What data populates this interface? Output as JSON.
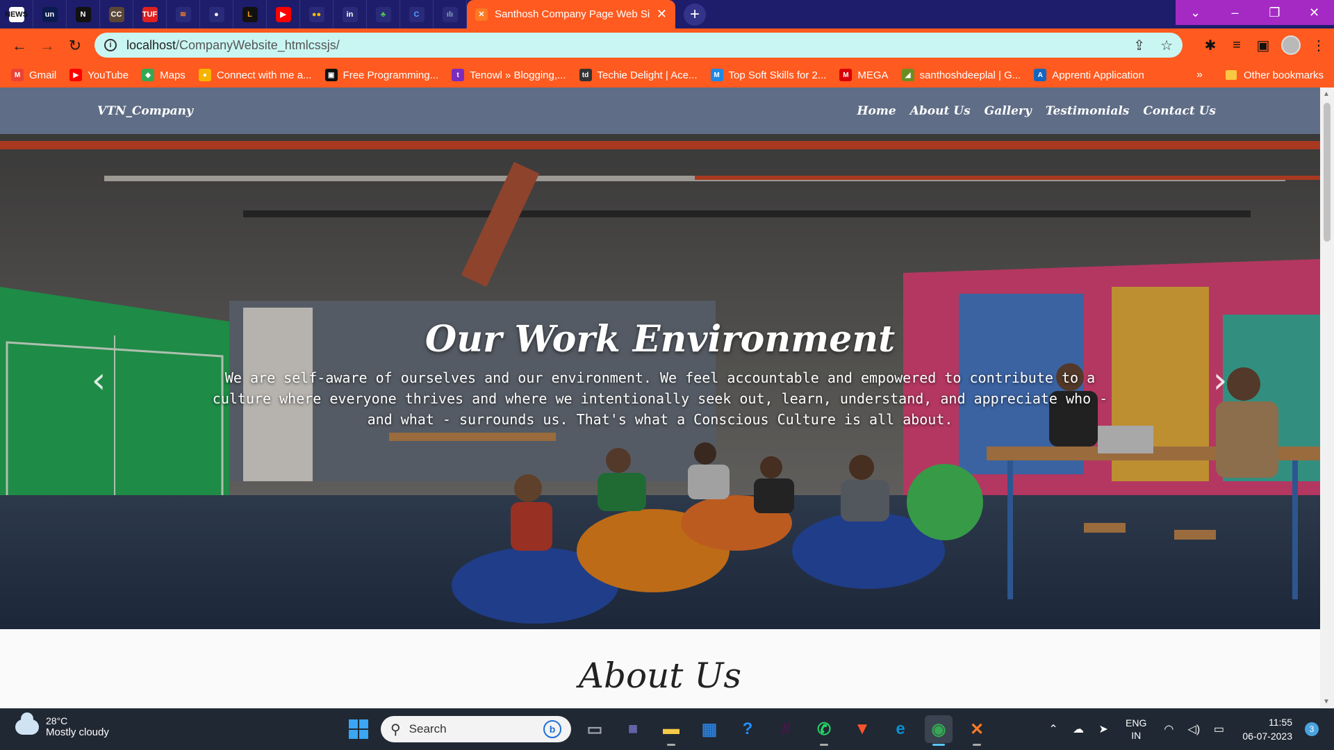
{
  "browser": {
    "pinned_tabs": [
      {
        "icon": "news-icon",
        "text": "NEWS",
        "color": "#ffffff",
        "fg": "#111111"
      },
      {
        "icon": "unstop-icon",
        "text": "un",
        "color": "#0b1b4f",
        "fg": "#ffffff"
      },
      {
        "icon": "naukri-icon",
        "text": "N",
        "color": "#111111",
        "fg": "#ffffff"
      },
      {
        "icon": "codechef-icon",
        "text": "CC",
        "color": "#5b4636",
        "fg": "#ffffff"
      },
      {
        "icon": "tuf-icon",
        "text": "TUF",
        "color": "#e02020",
        "fg": "#ffffff"
      },
      {
        "icon": "stack-icon",
        "text": "≋",
        "color": "#2a2a7a",
        "fg": "#f48024"
      },
      {
        "icon": "github-icon",
        "text": "●",
        "color": "#2a2a7a",
        "fg": "#ffffff"
      },
      {
        "icon": "leetcode-icon",
        "text": "L",
        "color": "#111111",
        "fg": "#ffa116"
      },
      {
        "icon": "youtube-icon",
        "text": "▶",
        "color": "#ff0000",
        "fg": "#ffffff"
      },
      {
        "icon": "google-icon",
        "text": "●●",
        "color": "#2a2a7a",
        "fg": "#fbbc05"
      },
      {
        "icon": "linkedin-icon",
        "text": "in",
        "color": "#2a2a7a",
        "fg": "#ffffff"
      },
      {
        "icon": "leaf-icon",
        "text": "♣",
        "color": "#2a2a7a",
        "fg": "#4ec94e"
      },
      {
        "icon": "c-icon",
        "text": "C",
        "color": "#2a2a7a",
        "fg": "#4fa3ff"
      },
      {
        "icon": "cisco-icon",
        "text": "ılı",
        "color": "#2a2a7a",
        "fg": "#8aa0c0"
      }
    ],
    "active_tab_title": "Santhosh Company Page Web Si",
    "url_host": "localhost",
    "url_path": "/CompanyWebsite_htmlcssjs/",
    "bookmarks": [
      {
        "label": "Gmail",
        "icon": "gmail-icon",
        "color": "#ea4335",
        "glyph": "M"
      },
      {
        "label": "YouTube",
        "icon": "youtube-icon",
        "color": "#ff0000",
        "glyph": "▶"
      },
      {
        "label": "Maps",
        "icon": "maps-icon",
        "color": "#34a853",
        "glyph": "◆"
      },
      {
        "label": "Connect with me a...",
        "icon": "connect-icon",
        "color": "#f4b400",
        "glyph": "●"
      },
      {
        "label": "Free Programming...",
        "icon": "programming-icon",
        "color": "#111111",
        "glyph": "▣"
      },
      {
        "label": "Tenowl » Blogging,...",
        "icon": "tenowl-icon",
        "color": "#7b2cbf",
        "glyph": "t"
      },
      {
        "label": "Techie Delight | Ace...",
        "icon": "techie-delight-icon",
        "color": "#333333",
        "glyph": "td"
      },
      {
        "label": "Top Soft Skills for 2...",
        "icon": "soft-skills-icon",
        "color": "#1e88e5",
        "glyph": "M"
      },
      {
        "label": "MEGA",
        "icon": "mega-icon",
        "color": "#d90007",
        "glyph": "M"
      },
      {
        "label": "santhoshdeeplal | G...",
        "icon": "gitlab-icon",
        "color": "#6b8e23",
        "glyph": "◢"
      },
      {
        "label": "Apprenti Application",
        "icon": "apprenti-icon",
        "color": "#1565c0",
        "glyph": "A"
      }
    ],
    "other_bookmarks": "Other bookmarks",
    "more_bookmarks": "»"
  },
  "site": {
    "brand": "VTN_Company",
    "menu": [
      "Home",
      "About Us",
      "Gallery",
      "Testimonials",
      "Contact Us"
    ],
    "hero": {
      "title": "Our Work Environment",
      "text": "We are self-aware of ourselves and our environment. We feel accountable and empowered to contribute to a culture where everyone thrives and where we intentionally seek out, learn, understand, and appreciate who - and what - surrounds us. That's what a Conscious Culture is all about.",
      "prev": "‹",
      "next": "›"
    },
    "about_heading": "About Us"
  },
  "taskbar": {
    "weather_temp": "28°C",
    "weather_desc": "Mostly cloudy",
    "search_placeholder": "Search",
    "apps": [
      {
        "icon": "task-view-icon",
        "glyph": "▭",
        "color": "#9aa3ad"
      },
      {
        "icon": "teams-chat-icon",
        "glyph": "■",
        "color": "#6264a7"
      },
      {
        "icon": "file-explorer-icon",
        "glyph": "▬",
        "color": "#f7c948"
      },
      {
        "icon": "ms-store-icon",
        "glyph": "▦",
        "color": "#2b7cd3"
      },
      {
        "icon": "help-icon",
        "glyph": "?",
        "color": "#1e90ff"
      },
      {
        "icon": "slack-icon",
        "glyph": "#",
        "color": "#4a154b"
      },
      {
        "icon": "whatsapp-icon",
        "glyph": "✆",
        "color": "#25d366"
      },
      {
        "icon": "brave-icon",
        "glyph": "▼",
        "color": "#fb542b"
      },
      {
        "icon": "edge-icon",
        "glyph": "e",
        "color": "#0c8fcf"
      },
      {
        "icon": "chrome-icon",
        "glyph": "◉",
        "color": "#34a853"
      },
      {
        "icon": "xampp-icon",
        "glyph": "✕",
        "color": "#fb7a24"
      }
    ],
    "language_top": "ENG",
    "language_bottom": "IN",
    "time": "11:55",
    "date": "06-07-2023",
    "notifications": "3"
  }
}
